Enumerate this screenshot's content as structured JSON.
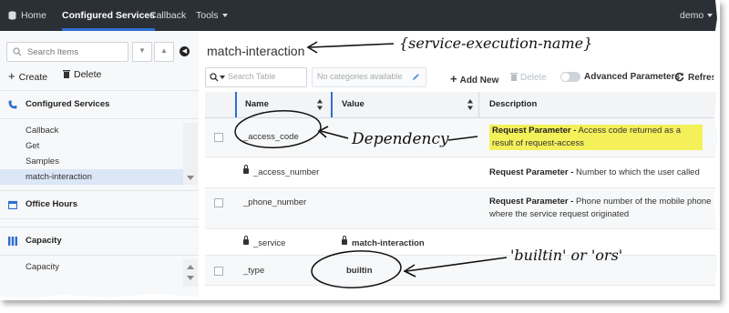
{
  "nav": {
    "home_label": "Home",
    "configured_services_label": "Configured Services",
    "callback_label": "Callback",
    "tools_label": "Tools",
    "user_label": "demo"
  },
  "sidebar": {
    "search_placeholder": "Search Items",
    "create_label": "Create",
    "delete_label": "Delete",
    "sections": [
      {
        "label": "Configured Services",
        "items": [
          "Callback",
          "Get",
          "Samples",
          "match-interaction"
        ]
      },
      {
        "label": "Office Hours",
        "items": []
      },
      {
        "label": "Capacity",
        "items": [
          "Capacity"
        ]
      }
    ],
    "selected_item": "match-interaction"
  },
  "main": {
    "title": "match-interaction",
    "table_search_placeholder": "Search Table",
    "category_placeholder": "No categories available",
    "add_new_label": "Add New",
    "delete_label": "Delete",
    "advanced_label": "Advanced Parameters",
    "refresh_label": "Refres",
    "columns": [
      "Name",
      "Value",
      "Description"
    ],
    "rows": [
      {
        "name": "_access_code",
        "value": "",
        "desc_bold": "Request Parameter -",
        "desc_rest": " Access code returned as a result of request-access",
        "locked": false,
        "value_locked": false,
        "highlight": true
      },
      {
        "name": "_access_number",
        "value": "",
        "desc_bold": "Request Parameter -",
        "desc_rest": " Number to which the user called",
        "locked": true,
        "value_locked": false,
        "highlight": false
      },
      {
        "name": "_phone_number",
        "value": "",
        "desc_bold": "Request Parameter -",
        "desc_rest": " Phone number of the mobile phone where the service request originated",
        "locked": false,
        "value_locked": false,
        "highlight": false
      },
      {
        "name": "_service",
        "value": "match-interaction",
        "desc_bold": "",
        "desc_rest": "",
        "locked": true,
        "value_locked": true,
        "highlight": false
      },
      {
        "name": "_type",
        "value": "builtin",
        "desc_bold": "",
        "desc_rest": "",
        "locked": false,
        "value_locked": false,
        "highlight": false
      }
    ]
  },
  "annotations": {
    "title_note": "{service-execution-name}",
    "dependency_note": "Dependency",
    "type_note": "'builtin' or 'ors'"
  }
}
